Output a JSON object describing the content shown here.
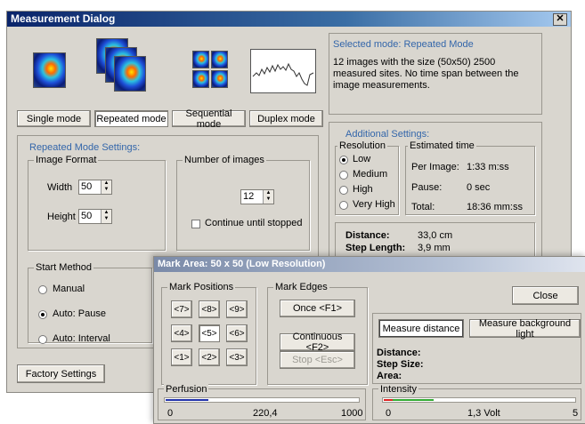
{
  "main": {
    "title": "Measurement Dialog",
    "close_glyph": "✕",
    "modes": [
      "Single mode",
      "Repeated mode",
      "Sequential mode",
      "Duplex mode"
    ],
    "info_title": "Selected mode: Repeated Mode",
    "info_text": "12 images with the size (50x50) 2500 measured sites. No time span between the image measurements.",
    "repeated_settings": {
      "title": "Repeated Mode Settings:",
      "image_format_label": "Image Format",
      "width_label": "Width",
      "width_value": "50",
      "height_label": "Height",
      "height_value": "50",
      "num_images_label": "Number of images",
      "num_images_value": "12",
      "continue_label": "Continue until stopped"
    },
    "start_method": {
      "label": "Start Method",
      "options": [
        "Manual",
        "Auto: Pause",
        "Auto: Interval"
      ],
      "selected": 1
    },
    "factory_button": "Factory Settings",
    "additional": {
      "title": "Additional Settings:",
      "resolution_label": "Resolution",
      "resolutions": [
        "Low",
        "Medium",
        "High",
        "Very High"
      ],
      "resolution_selected": 0,
      "estimated_label": "Estimated time",
      "est_rows": [
        {
          "label": "Per Image:",
          "value": "1:33 m:ss"
        },
        {
          "label": "Pause:",
          "value": "0 sec"
        },
        {
          "label": "Total:",
          "value": "18:36 mm:ss"
        }
      ],
      "distance_label": "Distance:",
      "distance_value": "33,0 cm",
      "step_label": "Step Length:",
      "step_value": "3,9 mm"
    }
  },
  "mark_dialog": {
    "title": "Mark Area: 50 x 50 (Low Resolution)",
    "positions_label": "Mark Positions",
    "positions": [
      "<7>",
      "<8>",
      "<9>",
      "<4>",
      "<5>",
      "<6>",
      "<1>",
      "<2>",
      "<3>"
    ],
    "edges_label": "Mark Edges",
    "once_button": "Once <F1>",
    "continuous_button": "Continuous <F2>",
    "stop_button": "Stop <Esc>",
    "close_button": "Close",
    "measure_distance_button": "Measure distance",
    "measure_background_button": "Measure background light",
    "distance_label": "Distance:",
    "step_size_label": "Step Size:",
    "area_label": "Area:",
    "perfusion": {
      "label": "Perfusion",
      "min": "0",
      "value": "220,4",
      "max": "1000",
      "fraction": 0.22
    },
    "intensity": {
      "label": "Intensity",
      "min": "0",
      "value": "1,3 Volt",
      "max": "5",
      "fraction": 0.26
    },
    "colors": {
      "perfusion_bar": "#2233aa",
      "intensity_red": "#dd2222",
      "intensity_green": "#33aa33"
    }
  }
}
